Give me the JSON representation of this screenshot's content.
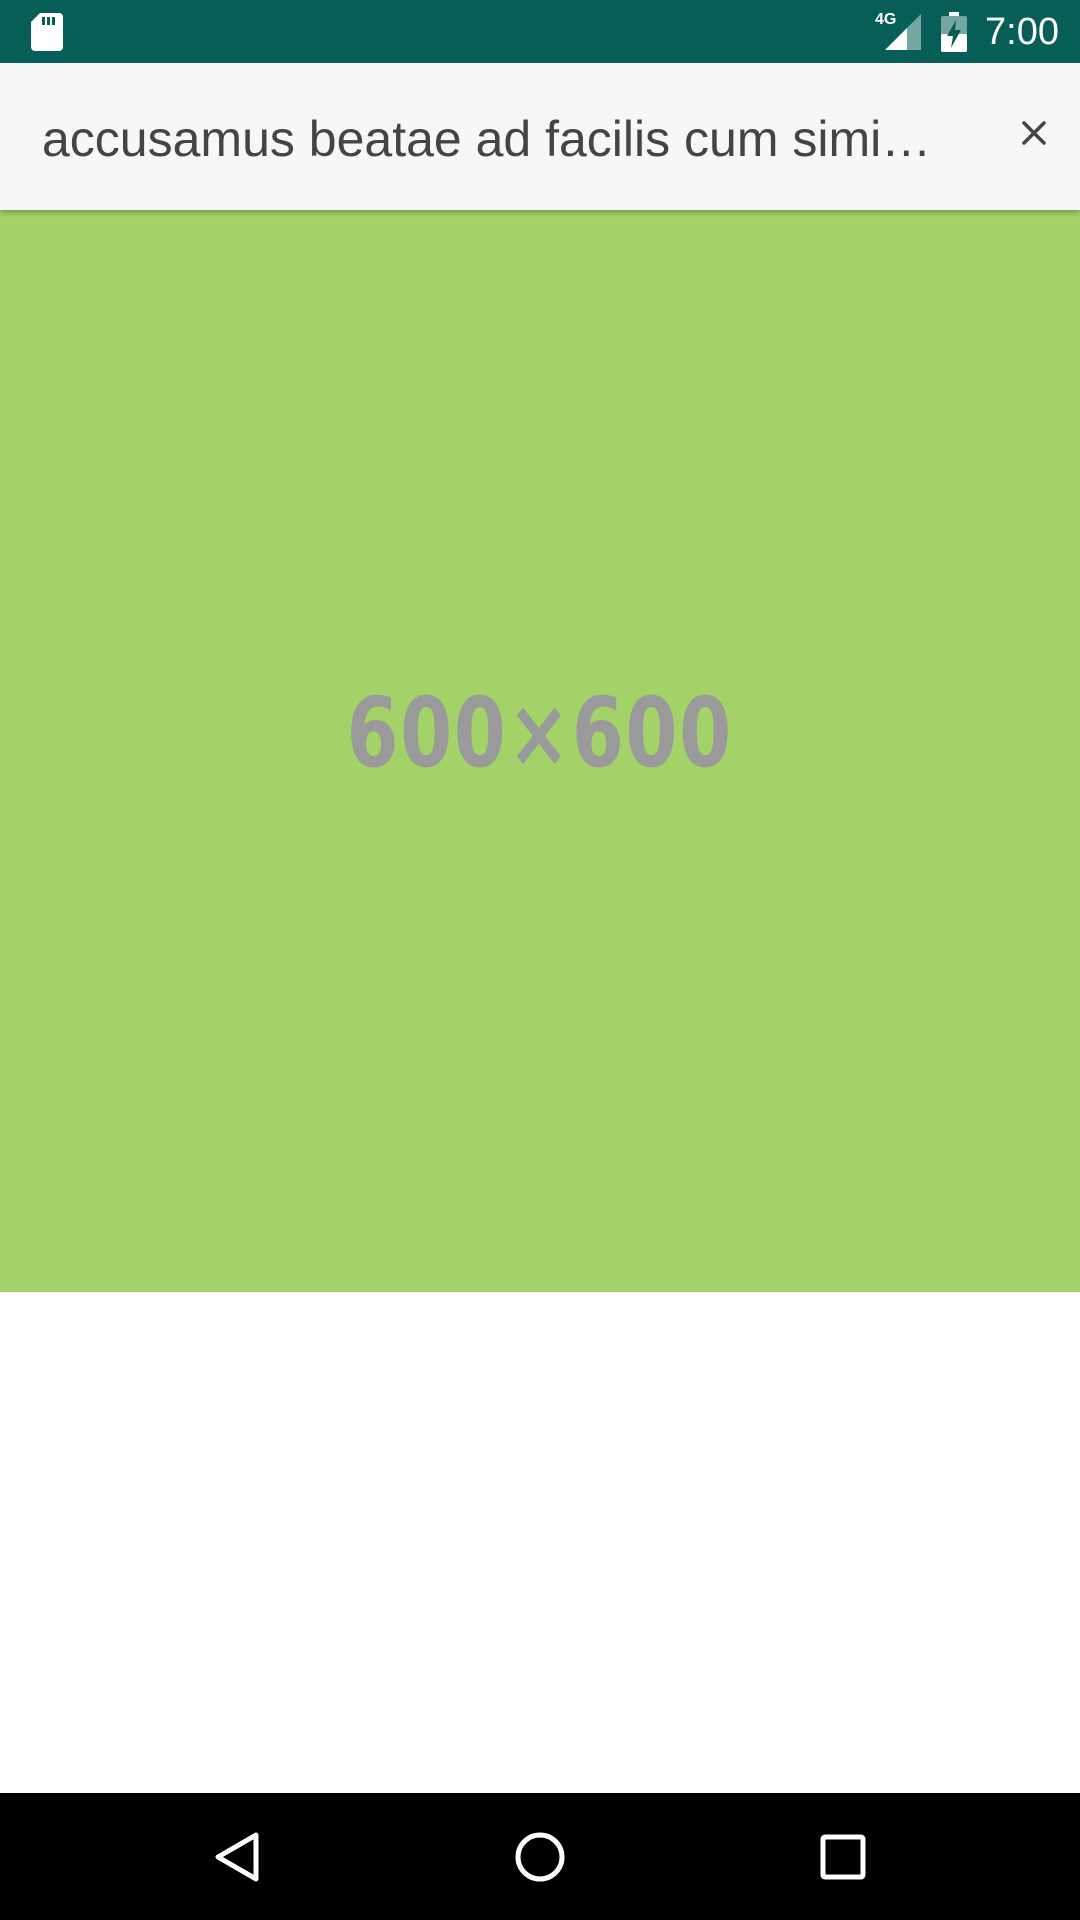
{
  "status_bar": {
    "time": "7:00",
    "network_type": "4G",
    "icons": [
      "sd-card-icon",
      "signal-icon",
      "battery-charging-icon"
    ]
  },
  "app_bar": {
    "title": "accusamus beatae ad facilis cum simi…",
    "close_icon": "close-icon"
  },
  "content": {
    "image_label": "600×600",
    "image_background": "#a3d368"
  },
  "nav_bar": {
    "icons": [
      "back-icon",
      "home-icon",
      "recents-icon"
    ]
  },
  "colors": {
    "status_bar": "#075e57",
    "app_bar": "#f7f7f7",
    "title_text": "#444444",
    "placeholder_text": "#9a9a9a",
    "nav_bar": "#000000"
  }
}
